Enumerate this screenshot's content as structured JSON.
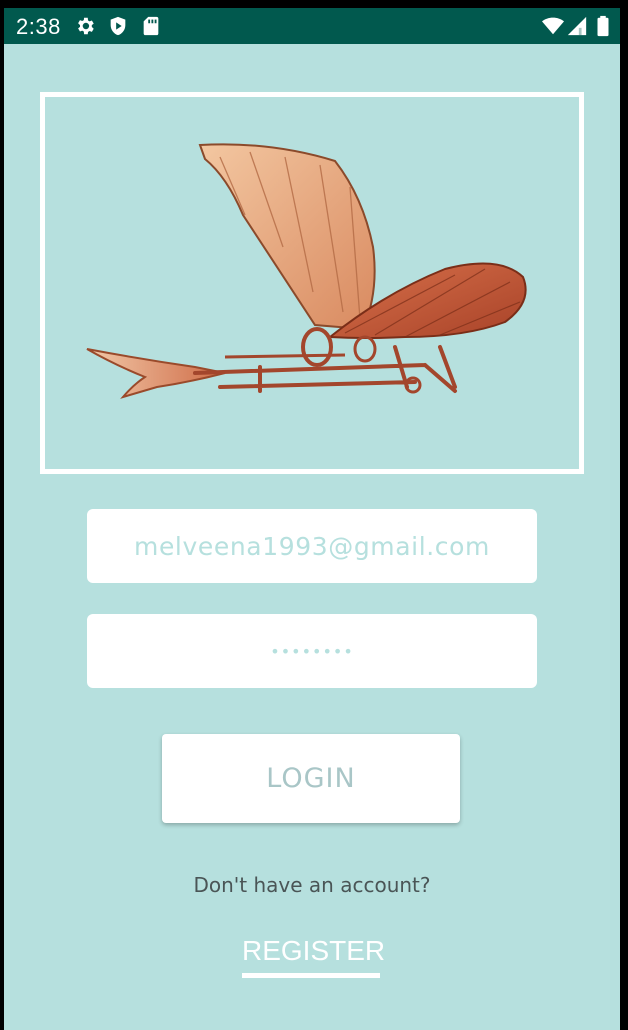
{
  "status_bar": {
    "time": "2:38",
    "left_icons": [
      "gear-icon",
      "play-shield-icon",
      "sd-card-icon"
    ],
    "right_icons": [
      "wifi-icon",
      "signal-icon",
      "battery-icon"
    ]
  },
  "logo": {
    "description_icon": "ornithopter-flying-machine-image"
  },
  "login_form": {
    "email_value": "melveena1993@gmail.com",
    "password_value": "••••••••",
    "login_label": "LOGIN"
  },
  "footer": {
    "no_account_text": "Don't have an account?",
    "register_label": "REGISTER"
  },
  "colors": {
    "status_bar": "#01594e",
    "background": "#b6e0de",
    "field_text": "#b6e0de",
    "login_text": "#a9c6c7"
  }
}
